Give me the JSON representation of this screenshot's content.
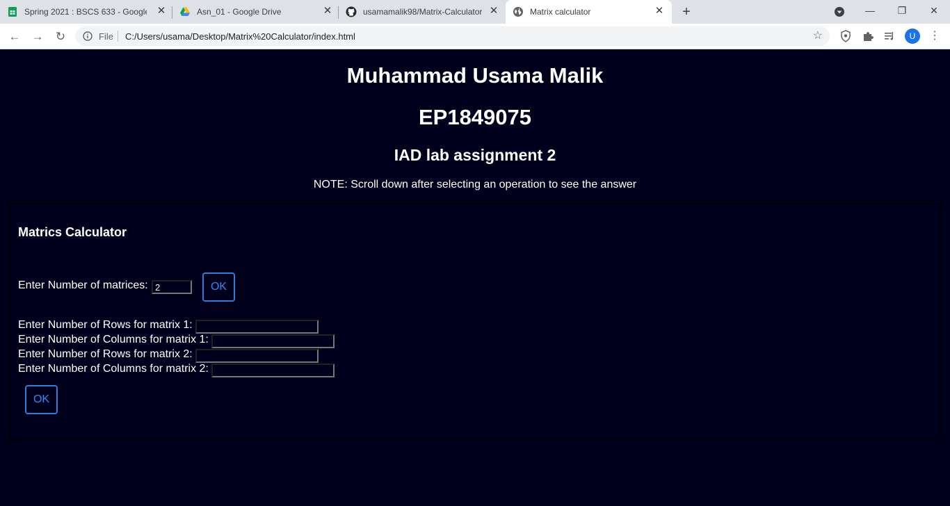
{
  "browser": {
    "tabs": [
      {
        "title": "Spring 2021 : BSCS 633 - Google",
        "icon": "google-sheets-icon"
      },
      {
        "title": "Asn_01 - Google Drive",
        "icon": "google-drive-icon"
      },
      {
        "title": "usamamalik98/Matrix-Calculator",
        "icon": "github-icon"
      },
      {
        "title": "Matrix calculator",
        "icon": "globe-icon"
      }
    ],
    "address": {
      "scheme_label": "File",
      "url": "C:/Users/usama/Desktop/Matrix%20Calculator/index.html"
    },
    "profile_initial": "U"
  },
  "page": {
    "name": "Muhammad Usama Malik",
    "id": "EP1849075",
    "assignment": "IAD lab assignment 2",
    "note": "NOTE: Scroll down after selecting an operation to see the answer",
    "calculator": {
      "title": "Matrics Calculator",
      "num_matrices_label": "Enter Number of matrices:",
      "num_matrices_value": "2",
      "ok_label": "OK",
      "fields": [
        {
          "label": "Enter Number of Rows for matrix 1:",
          "value": ""
        },
        {
          "label": "Enter Number of Columns for matrix 1:",
          "value": ""
        },
        {
          "label": "Enter Number of Rows for matrix 2:",
          "value": ""
        },
        {
          "label": "Enter Number of Columns for matrix 2:",
          "value": ""
        }
      ],
      "submit_label": "OK"
    }
  },
  "colors": {
    "page_background": "#00001d",
    "text": "#ffffff",
    "button_accent": "#2d8cf0"
  }
}
